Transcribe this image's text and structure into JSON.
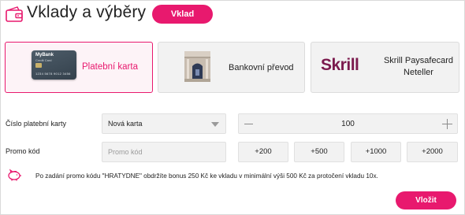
{
  "header": {
    "title": "Vklady a výběry",
    "deposit_button": "Vklad"
  },
  "payment_methods": [
    {
      "label": "Platební karta",
      "selected": true,
      "card_image": {
        "bank_name": "MyBank",
        "card_type": "Credit Card",
        "number": "1234 5678 9012 3456"
      }
    },
    {
      "label": "Bankovní převod",
      "selected": false,
      "icon": "bank-building-icon"
    },
    {
      "label": "Skrill Paysafecard Neteller",
      "selected": false,
      "logo_text": "Skrill"
    }
  ],
  "form": {
    "card_number_label": "Číslo platební karty",
    "card_select_value": "Nová karta",
    "amount": "100",
    "promo_label": "Promo kód",
    "promo_placeholder": "Promo kód",
    "quick_amounts": [
      "+200",
      "+500",
      "+1000",
      "+2000"
    ]
  },
  "notice": {
    "text": "Po zadání promo kódu \"HRATYDNE\" obdržíte bonus 250 Kč ke vkladu v minimální výši 500 Kč za protočení vkladu 10x.",
    "icon": "piggy-bank-icon"
  },
  "submit_button": "Vložit",
  "colors": {
    "accent": "#e8196e",
    "skrill": "#7b1a4d",
    "field_bg": "#f2f2f2"
  }
}
